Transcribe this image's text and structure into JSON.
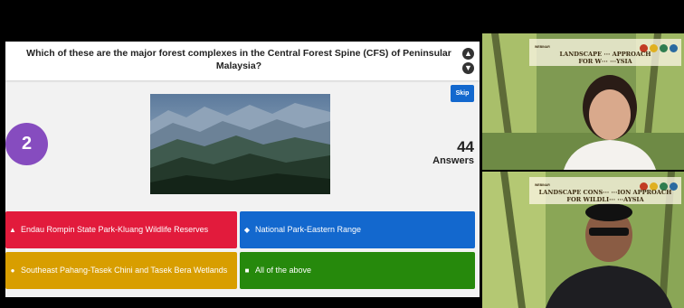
{
  "quiz": {
    "question": "Which of these are the major forest complexes in the Central Forest Spine (CFS) of Peninsular Malaysia?",
    "skip_label": "Skip",
    "timer_value": "2",
    "answers_count": "44",
    "answers_label": "Answers",
    "up_icon": "chevron-up-icon",
    "down_icon": "chevron-down-icon",
    "options": [
      {
        "shape": "triangle-icon",
        "glyph": "▲",
        "label": "Endau Rompin State Park-Kluang Wildlife Reserves",
        "color": "#e21b3c"
      },
      {
        "shape": "diamond-icon",
        "glyph": "◆",
        "label": "National Park-Eastern Range",
        "color": "#1368ce"
      },
      {
        "shape": "circle-icon",
        "glyph": "●",
        "label": "Southeast Pahang-Tasek Chini and Tasek Bera Wetlands",
        "color": "#d89e00"
      },
      {
        "shape": "square-icon",
        "glyph": "■",
        "label": "All of the above",
        "color": "#26890c"
      }
    ]
  },
  "webinar": {
    "banner_small": "WEBINAR",
    "banner_title_1": "LANDSCAPE ··· APPROACH",
    "banner_title_2": "FOR W··· ···YSIA",
    "banner_title_3": "LANDSCAPE CONS··· ···ION APPROACH",
    "banner_title_4": "FOR WILDLI··· ···AYSIA"
  }
}
